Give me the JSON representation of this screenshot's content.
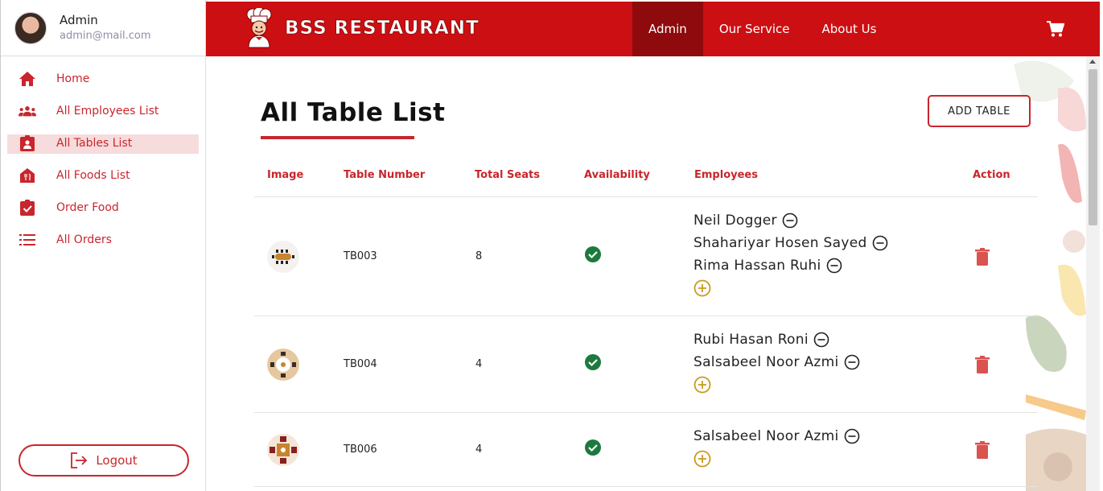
{
  "sidebar": {
    "user_name": "Admin",
    "user_email": "admin@mail.com",
    "items": [
      {
        "label": "Home",
        "icon": "home-icon"
      },
      {
        "label": "All Employees List",
        "icon": "people-icon"
      },
      {
        "label": "All Tables List",
        "icon": "badge-icon"
      },
      {
        "label": "All Foods List",
        "icon": "restaurant-icon"
      },
      {
        "label": "Order Food",
        "icon": "clipboard-check-icon"
      },
      {
        "label": "All Orders",
        "icon": "list-icon"
      }
    ],
    "active_item": "All Tables List",
    "logout_label": "Logout"
  },
  "header": {
    "brand": "BSS RESTAURANT",
    "menu": [
      "Admin",
      "Our Service",
      "About Us"
    ],
    "active_menu": "Admin"
  },
  "main": {
    "title": "All Table List",
    "add_button": "ADD TABLE",
    "columns": [
      "Image",
      "Table Number",
      "Total Seats",
      "Availability",
      "Employees",
      "Action"
    ],
    "rows": [
      {
        "table_number": "TB003",
        "total_seats": "8",
        "available": true,
        "employees": [
          "Neil Dogger",
          "Shahariyar Hosen Sayed",
          "Rima Hassan Ruhi"
        ]
      },
      {
        "table_number": "TB004",
        "total_seats": "4",
        "available": true,
        "employees": [
          "Rubi Hasan Roni",
          "Salsabeel Noor Azmi"
        ]
      },
      {
        "table_number": "TB006",
        "total_seats": "4",
        "available": true,
        "employees": [
          "Salsabeel Noor Azmi"
        ]
      }
    ]
  },
  "colors": {
    "brand_red": "#cc0f12",
    "active_menu_bg": "#8e0a0c",
    "success_green": "#1d7a3e",
    "add_icon_gold": "#c99a1c",
    "delete_red": "#d9534f"
  }
}
